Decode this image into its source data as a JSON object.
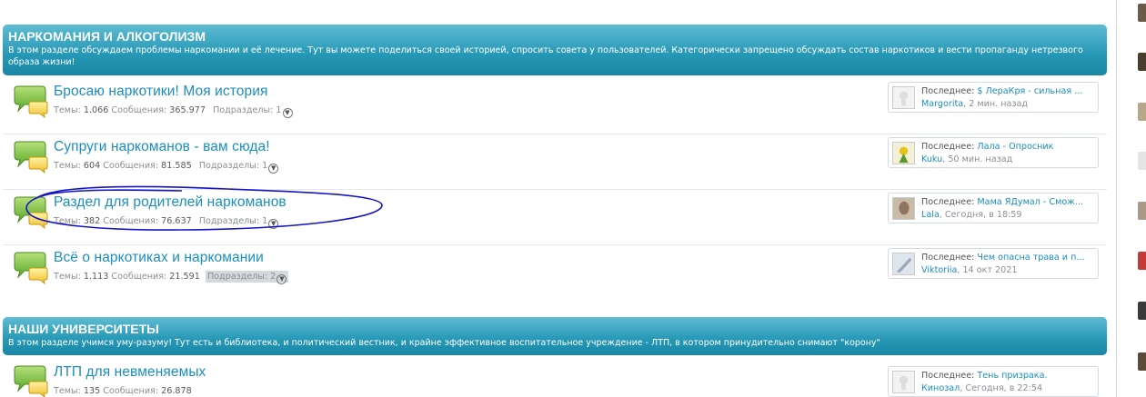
{
  "sections": [
    {
      "title": "НАРКОМАНИЯ И АЛКОГОЛИЗМ",
      "description": "В этом разделе обсуждаем проблемы наркомании и её лечение. Тут вы можете поделиться своей историей, спросить совета у пользователей. Категорически запрещено обсуждать состав наркотиков и вести пропаганду нетрезвого образа жизни!",
      "forums": [
        {
          "title": "Бросаю наркотики! Моя история",
          "threads_label": "Темы:",
          "threads": "1.066",
          "messages_label": "Сообщения:",
          "messages": "365.977",
          "sub_label": "Подразделы: 1",
          "last_label": "Последнее:",
          "last_thread": "$ ЛераКря - сильная ...",
          "last_user": "Margorita",
          "last_time": ", 2 мин. назад"
        },
        {
          "title": "Супруги наркоманов - вам сюда!",
          "threads_label": "Темы:",
          "threads": "604",
          "messages_label": "Сообщения:",
          "messages": "81.585",
          "sub_label": "Подразделы: 1",
          "last_label": "Последнее:",
          "last_thread": "Лала - Опросник",
          "last_user": "Kuku",
          "last_time": ", 50 мин. назад"
        },
        {
          "title": "Раздел для родителей наркоманов",
          "threads_label": "Темы:",
          "threads": "382",
          "messages_label": "Сообщения:",
          "messages": "76.637",
          "sub_label": "Подразделы: 1",
          "last_label": "Последнее:",
          "last_thread": "Мама ЯДумал - Смож...",
          "last_user": "Lala",
          "last_time": ", Сегодня, в 18:59"
        },
        {
          "title": "Всё о наркотиках и наркомании",
          "threads_label": "Темы:",
          "threads": "1.113",
          "messages_label": "Сообщения:",
          "messages": "21.591",
          "sub_label": "Подразделы: 2",
          "last_label": "Последнее:",
          "last_thread": "Чем опасна трава и п...",
          "last_user": "Viktoriia",
          "last_time": ", 14 окт 2021"
        }
      ]
    },
    {
      "title": "НАШИ УНИВЕРСИТЕТЫ",
      "description": "В этом разделе учимся уму-разуму! Тут есть и библиотека, и политический вестник, и крайне эффективное воспитательное учреждение - ЛТП, в котором принудительно снимают \"корону\"",
      "forums": [
        {
          "title": "ЛТП для невменяемых",
          "threads_label": "Темы:",
          "threads": "135",
          "messages_label": "Сообщения:",
          "messages": "26.878",
          "last_label": "Последнее:",
          "last_thread": "Тень призрака.",
          "last_user": "Кинозал",
          "last_time": ", Сегодня, в 22:54"
        }
      ]
    }
  ],
  "colors": {
    "header": "#2597b5",
    "link": "#1a8fbf",
    "annotation": "#1515c8"
  }
}
